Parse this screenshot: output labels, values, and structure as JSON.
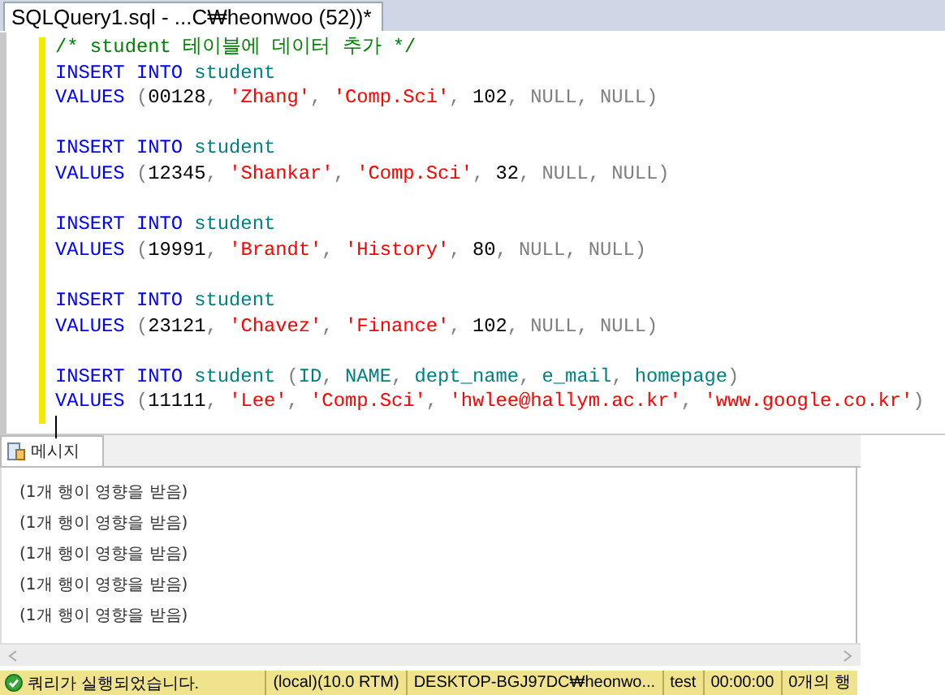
{
  "editor_tab": {
    "title": "SQLQuery1.sql - ...C₩heonwoo (52))*",
    "selected": true
  },
  "editor": {
    "comment": "/* student 테이블에 데이터 추가 */",
    "statements": [
      [
        [
          {
            "kind": "keyword",
            "text": "INSERT INTO"
          },
          {
            "kind": "ident",
            "text": " student"
          }
        ],
        [
          {
            "kind": "keyword",
            "text": "VALUES"
          },
          {
            "kind": "punct",
            "text": " ("
          },
          {
            "kind": "number",
            "text": "00128"
          },
          {
            "kind": "punct",
            "text": ", "
          },
          {
            "kind": "string",
            "text": "'Zhang'"
          },
          {
            "kind": "punct",
            "text": ", "
          },
          {
            "kind": "string",
            "text": "'Comp.Sci'"
          },
          {
            "kind": "punct",
            "text": ", "
          },
          {
            "kind": "number",
            "text": "102"
          },
          {
            "kind": "punct",
            "text": ", "
          },
          {
            "kind": "null",
            "text": "NULL"
          },
          {
            "kind": "punct",
            "text": ", "
          },
          {
            "kind": "null",
            "text": "NULL"
          },
          {
            "kind": "punct",
            "text": ")"
          }
        ]
      ],
      [
        [
          {
            "kind": "keyword",
            "text": "INSERT INTO"
          },
          {
            "kind": "ident",
            "text": " student"
          }
        ],
        [
          {
            "kind": "keyword",
            "text": "VALUES"
          },
          {
            "kind": "punct",
            "text": " ("
          },
          {
            "kind": "number",
            "text": "12345"
          },
          {
            "kind": "punct",
            "text": ", "
          },
          {
            "kind": "string",
            "text": "'Shankar'"
          },
          {
            "kind": "punct",
            "text": ", "
          },
          {
            "kind": "string",
            "text": "'Comp.Sci'"
          },
          {
            "kind": "punct",
            "text": ", "
          },
          {
            "kind": "number",
            "text": "32"
          },
          {
            "kind": "punct",
            "text": ", "
          },
          {
            "kind": "null",
            "text": "NULL"
          },
          {
            "kind": "punct",
            "text": ", "
          },
          {
            "kind": "null",
            "text": "NULL"
          },
          {
            "kind": "punct",
            "text": ")"
          }
        ]
      ],
      [
        [
          {
            "kind": "keyword",
            "text": "INSERT INTO"
          },
          {
            "kind": "ident",
            "text": " student"
          }
        ],
        [
          {
            "kind": "keyword",
            "text": "VALUES"
          },
          {
            "kind": "punct",
            "text": " ("
          },
          {
            "kind": "number",
            "text": "19991"
          },
          {
            "kind": "punct",
            "text": ", "
          },
          {
            "kind": "string",
            "text": "'Brandt'"
          },
          {
            "kind": "punct",
            "text": ", "
          },
          {
            "kind": "string",
            "text": "'History'"
          },
          {
            "kind": "punct",
            "text": ", "
          },
          {
            "kind": "number",
            "text": "80"
          },
          {
            "kind": "punct",
            "text": ", "
          },
          {
            "kind": "null",
            "text": "NULL"
          },
          {
            "kind": "punct",
            "text": ", "
          },
          {
            "kind": "null",
            "text": "NULL"
          },
          {
            "kind": "punct",
            "text": ")"
          }
        ]
      ],
      [
        [
          {
            "kind": "keyword",
            "text": "INSERT INTO"
          },
          {
            "kind": "ident",
            "text": " student"
          }
        ],
        [
          {
            "kind": "keyword",
            "text": "VALUES"
          },
          {
            "kind": "punct",
            "text": " ("
          },
          {
            "kind": "number",
            "text": "23121"
          },
          {
            "kind": "punct",
            "text": ", "
          },
          {
            "kind": "string",
            "text": "'Chavez'"
          },
          {
            "kind": "punct",
            "text": ", "
          },
          {
            "kind": "string",
            "text": "'Finance'"
          },
          {
            "kind": "punct",
            "text": ", "
          },
          {
            "kind": "number",
            "text": "102"
          },
          {
            "kind": "punct",
            "text": ", "
          },
          {
            "kind": "null",
            "text": "NULL"
          },
          {
            "kind": "punct",
            "text": ", "
          },
          {
            "kind": "null",
            "text": "NULL"
          },
          {
            "kind": "punct",
            "text": ")"
          }
        ]
      ],
      [
        [
          {
            "kind": "keyword",
            "text": "INSERT INTO"
          },
          {
            "kind": "ident",
            "text": " student "
          },
          {
            "kind": "punct",
            "text": "("
          },
          {
            "kind": "ident",
            "text": "ID"
          },
          {
            "kind": "punct",
            "text": ", "
          },
          {
            "kind": "ident",
            "text": "NAME"
          },
          {
            "kind": "punct",
            "text": ", "
          },
          {
            "kind": "ident",
            "text": "dept_name"
          },
          {
            "kind": "punct",
            "text": ", "
          },
          {
            "kind": "ident",
            "text": "e_mail"
          },
          {
            "kind": "punct",
            "text": ", "
          },
          {
            "kind": "ident",
            "text": "homepage"
          },
          {
            "kind": "punct",
            "text": ")"
          }
        ],
        [
          {
            "kind": "keyword",
            "text": "VALUES"
          },
          {
            "kind": "punct",
            "text": " ("
          },
          {
            "kind": "number",
            "text": "11111"
          },
          {
            "kind": "punct",
            "text": ", "
          },
          {
            "kind": "string",
            "text": "'Lee'"
          },
          {
            "kind": "punct",
            "text": ", "
          },
          {
            "kind": "string",
            "text": "'Comp.Sci'"
          },
          {
            "kind": "punct",
            "text": ", "
          },
          {
            "kind": "string",
            "text": "'hwlee@hallym.ac.kr'"
          },
          {
            "kind": "punct",
            "text": ", "
          },
          {
            "kind": "string",
            "text": "'www.google.co.kr'"
          },
          {
            "kind": "punct",
            "text": ")"
          }
        ]
      ]
    ]
  },
  "results_tab": {
    "label": "메시지",
    "selected": true
  },
  "messages": [
    "(1개 행이 영향을 받음)",
    "(1개 행이 영향을 받음)",
    "(1개 행이 영향을 받음)",
    "(1개 행이 영향을 받음)",
    "(1개 행이 영향을 받음)"
  ],
  "status_bar": {
    "message": "쿼리가 실행되었습니다.",
    "items": [
      "(local)(10.0 RTM)",
      "DESKTOP-BGJ97DC₩heonwo...",
      "test",
      "00:00:00",
      "0개의 행"
    ]
  }
}
